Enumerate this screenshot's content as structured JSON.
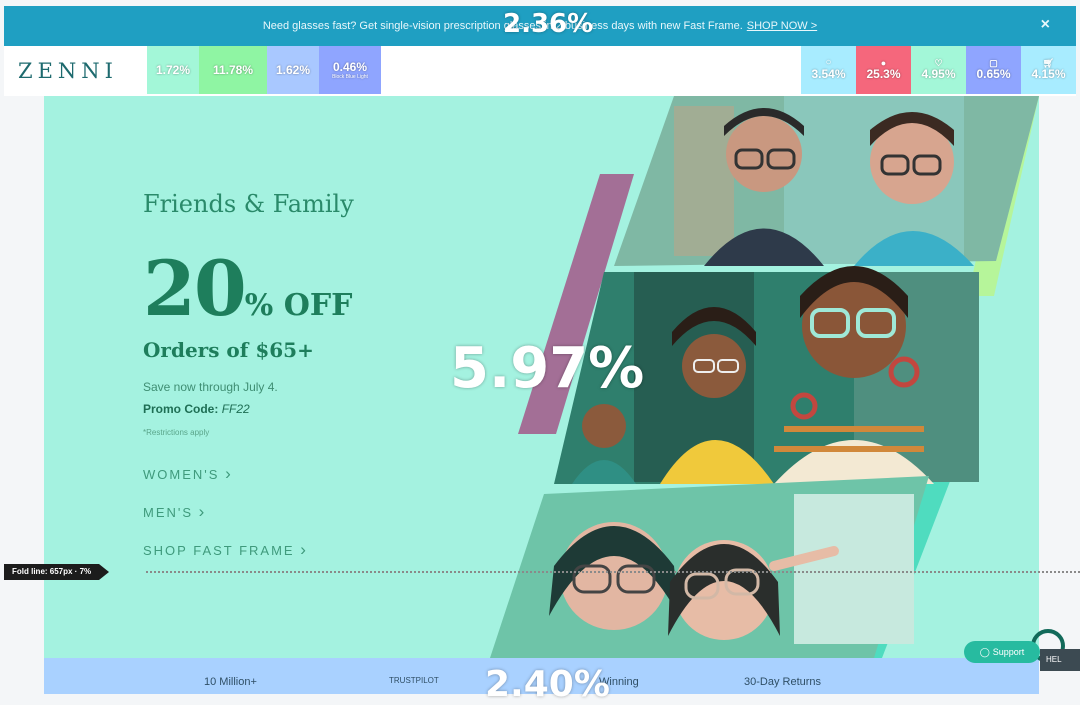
{
  "announcement": {
    "text": "Need glasses fast? Get single-vision prescription glasses in 2 business days with new Fast Frame.",
    "link": "SHOP NOW >",
    "close_symbol": "×"
  },
  "overlays": {
    "top": "2.36%",
    "center": "5.97%",
    "bottom": "2.40%"
  },
  "nav": {
    "logo": "ZENNI",
    "left_items": [
      {
        "value": "1.72%",
        "color": "#a3f7d8"
      },
      {
        "value": "11.78%",
        "color": "#8ff5a3"
      },
      {
        "value": "1.62%",
        "color": "#a9c8ff"
      },
      {
        "value": "0.46%",
        "sub": "Block Blue Light",
        "color": "#8fa5ff"
      }
    ],
    "right_items": [
      {
        "value": "3.54%",
        "color": "#a8ecff"
      },
      {
        "value": "25.3%",
        "color": "#f5677c"
      },
      {
        "value": "4.95%",
        "color": "#a3f7d8"
      },
      {
        "value": "0.65%",
        "color": "#8fa5ff"
      },
      {
        "value": "4.15%",
        "color": "#a8ecff"
      }
    ]
  },
  "hero": {
    "headline": "Friends & Family",
    "discount_number": "20",
    "discount_suffix": "% OFF",
    "orders": "Orders of $65+",
    "save_text": "Save now through July 4.",
    "promo_label": "Promo Code:",
    "promo_code": "FF22",
    "restrictions": "*Restrictions apply",
    "links": [
      "WOMEN'S",
      "MEN'S",
      "SHOP FAST FRAME"
    ],
    "link_chevron": "›"
  },
  "fold": {
    "label": "Fold line: 657px · 7%"
  },
  "support": {
    "label": "Support",
    "help": "HEL"
  },
  "bottom_strip": [
    "10 Million+",
    "TRUSTPILOT",
    "Winning",
    "30-Day Returns"
  ]
}
